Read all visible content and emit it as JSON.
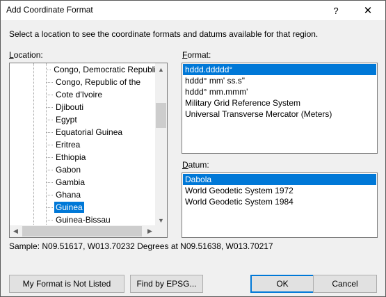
{
  "window": {
    "title": "Add Coordinate Format",
    "help_label": "?",
    "close_label": "✕"
  },
  "instruction": "Select a location to see the coordinate formats and datums available for that region.",
  "location": {
    "label_accel": "L",
    "label_rest": "ocation:",
    "items": [
      {
        "label": "Congo, Democratic Republi",
        "selected": false
      },
      {
        "label": "Congo, Republic of the",
        "selected": false
      },
      {
        "label": "Cote d'Ivoire",
        "selected": false
      },
      {
        "label": "Djibouti",
        "selected": false
      },
      {
        "label": "Egypt",
        "selected": false
      },
      {
        "label": "Equatorial Guinea",
        "selected": false
      },
      {
        "label": "Eritrea",
        "selected": false
      },
      {
        "label": "Ethiopia",
        "selected": false
      },
      {
        "label": "Gabon",
        "selected": false
      },
      {
        "label": "Gambia",
        "selected": false
      },
      {
        "label": "Ghana",
        "selected": false
      },
      {
        "label": "Guinea",
        "selected": true
      },
      {
        "label": "Guinea-Bissau",
        "selected": false
      }
    ],
    "scroll_up": "▲",
    "scroll_down": "▼",
    "scroll_left": "◀",
    "scroll_right": "▶"
  },
  "format": {
    "label_accel": "F",
    "label_rest": "ormat:",
    "items": [
      {
        "label": "hddd.ddddd°",
        "selected": true
      },
      {
        "label": "hddd° mm' ss.s\"",
        "selected": false
      },
      {
        "label": "hddd° mm.mmm'",
        "selected": false
      },
      {
        "label": "Military Grid Reference System",
        "selected": false
      },
      {
        "label": "Universal Transverse Mercator (Meters)",
        "selected": false
      }
    ]
  },
  "datum": {
    "label_accel": "D",
    "label_rest": "atum:",
    "items": [
      {
        "label": "Dabola",
        "selected": true
      },
      {
        "label": "World Geodetic System 1972",
        "selected": false
      },
      {
        "label": "World Geodetic System 1984",
        "selected": false
      }
    ]
  },
  "sample": "Sample: N09.51617, W013.70232 Degrees at N09.51638, W013.70217",
  "buttons": {
    "not_listed": "My Format is Not Listed",
    "find_epsg": "Find by EPSG...",
    "ok": "OK",
    "cancel": "Cancel"
  },
  "colors": {
    "selection": "#0078d7",
    "window_bg": "#f0f0f0"
  }
}
